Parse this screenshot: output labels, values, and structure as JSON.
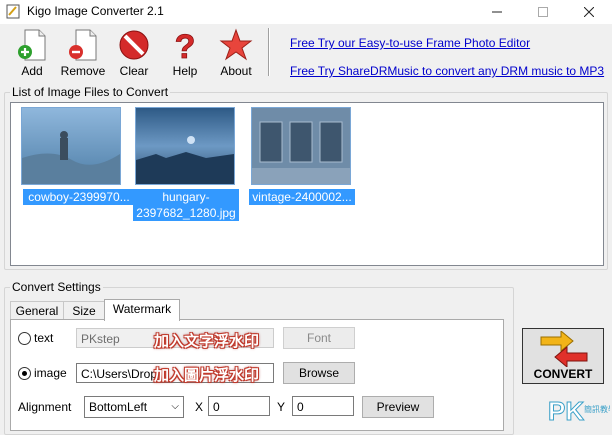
{
  "window": {
    "title": "Kigo Image Converter 2.1"
  },
  "toolbar": {
    "add_label": "Add",
    "remove_label": "Remove",
    "clear_label": "Clear",
    "help_label": "Help",
    "about_label": "About"
  },
  "links": {
    "frame_editor": "Free Try our Easy-to-use Frame Photo Editor",
    "sharedrmusic": "Free Try ShareDRMusic to convert any DRM music to MP3"
  },
  "file_list": {
    "title": "List of Image Files to Convert",
    "items": [
      {
        "name": "cowboy-2399970..."
      },
      {
        "name": "hungary-2397682_1280.jpg"
      },
      {
        "name": "vintage-2400002..."
      }
    ]
  },
  "convert_settings": {
    "title": "Convert Settings",
    "tabs": [
      "General",
      "Size",
      "Watermark"
    ],
    "active_tab": "Watermark",
    "text_option": {
      "label": "text",
      "value": "PKstep",
      "font_button": "Font"
    },
    "image_option": {
      "label": "image",
      "value": "C:\\Users\\Drop",
      "browse_button": "Browse"
    },
    "alignment": {
      "label": "Alignment",
      "value": "BottomLeft",
      "x_label": "X",
      "x_value": "0",
      "y_label": "Y",
      "y_value": "0",
      "preview_button": "Preview"
    }
  },
  "overlays": {
    "text_watermark": "加入文字浮水印",
    "image_watermark": "加入圖片浮水印"
  },
  "convert_button": {
    "label": "CONVERT"
  },
  "logo": {
    "text": "PK",
    "sub": "簡訊教學"
  },
  "colors": {
    "link": "#0000cc",
    "selection": "#3399ff",
    "overlay_stroke": "#c0392b"
  }
}
